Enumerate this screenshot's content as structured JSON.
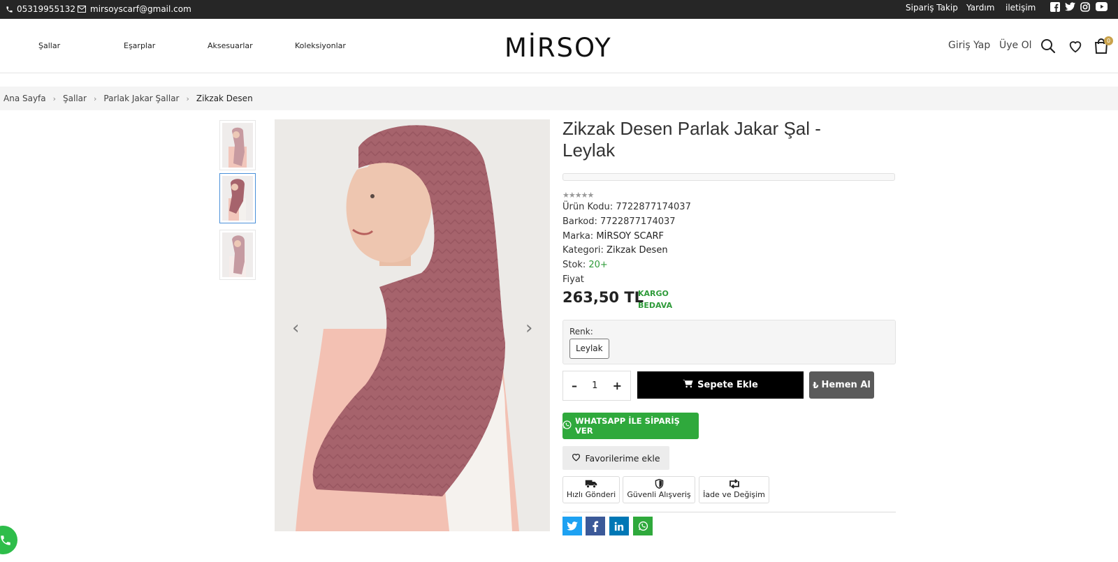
{
  "topbar": {
    "phone": "05319955132",
    "email": "mirsoyscarf@gmail.com",
    "links": [
      "Sipariş Takip",
      "Yardım",
      "iletişim"
    ],
    "social_icons": [
      "facebook-icon",
      "twitter-icon",
      "instagram-icon",
      "youtube-icon"
    ]
  },
  "header": {
    "nav": [
      "Şallar",
      "Eşarplar",
      "Aksesuarlar",
      "Koleksiyonlar"
    ],
    "logo": "MİRSOY",
    "login": "Giriş Yap",
    "register": "Üye Ol",
    "cart_count": "0"
  },
  "breadcrumb": [
    "Ana Sayfa",
    "Şallar",
    "Parlak Jakar Şallar",
    "Zikzak Desen"
  ],
  "product": {
    "title": "Zikzak Desen Parlak Jakar Şal - Leylak",
    "rating": "★★★★★",
    "code_label": "Ürün Kodu:",
    "code": "7722877174037",
    "barcode_label": "Barkod:",
    "barcode": "7722877174037",
    "brand_label": "Marka:",
    "brand": "MİRSOY SCARF",
    "category_label": "Kategori:",
    "category": "Zikzak Desen",
    "stock_label": "Stok:",
    "stock": "20+",
    "price_label": "Fiyat",
    "price": "263,50 TL",
    "shipping_line1": "KARGO",
    "shipping_line2": "BEDAVA",
    "variant_label": "Renk:",
    "variant_selected": "Leylak",
    "quantity": "1",
    "qty_minus": "–",
    "qty_plus": "+",
    "add_to_cart": "Sepete Ekle",
    "buy_now": "Hemen Al",
    "whatsapp_order": "WHATSAPP İLE SİPARİŞ VER",
    "favorite": "Favorilerime ekle",
    "features": [
      "Hızlı Gönderi",
      "Güvenli Alışveriş",
      "İade ve Değişim"
    ]
  },
  "colors": {
    "topbar_bg": "#262626",
    "accent_green": "#2fa93c",
    "cart_badge": "#c9a24b",
    "scarf": "#a6636c"
  }
}
